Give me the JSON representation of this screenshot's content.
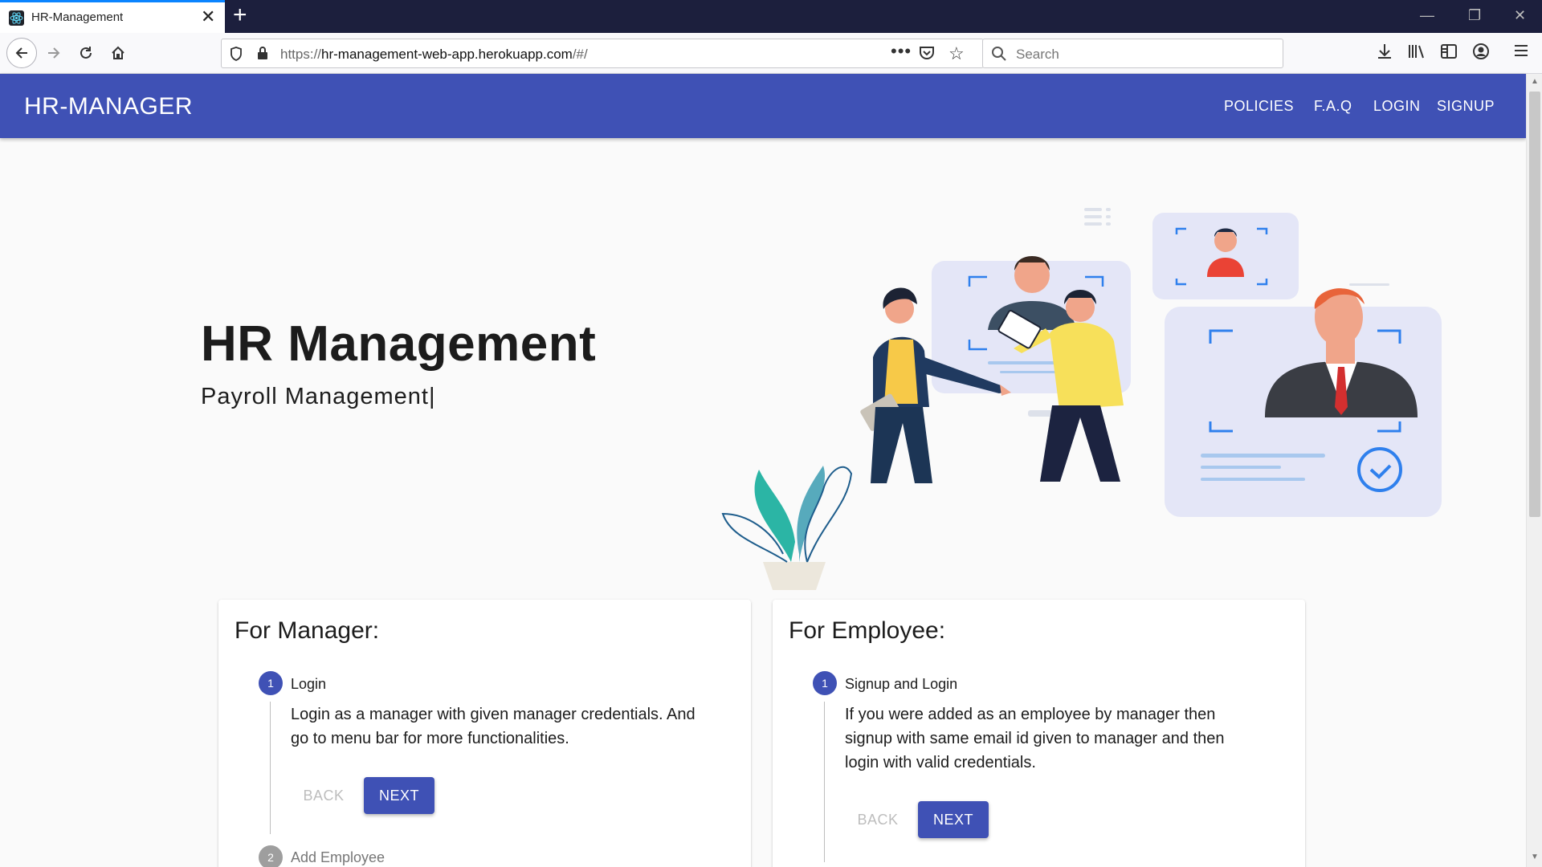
{
  "browser": {
    "tab_title": "HR-Management",
    "url_prefix": "https://",
    "url_host": "hr-management-web-app.herokuapp.com",
    "url_path": "/#/",
    "search_placeholder": "Search"
  },
  "app": {
    "brand": "HR-MANAGER",
    "nav": [
      {
        "label": "POLICIES"
      },
      {
        "label": "F.A.Q"
      },
      {
        "label": "LOGIN"
      },
      {
        "label": "SIGNUP"
      }
    ],
    "accent_color": "#3f51b5"
  },
  "hero": {
    "title": "HR Management",
    "subtitle": "Payroll Management"
  },
  "manager_card": {
    "heading": "For Manager:",
    "steps": [
      {
        "number": "1",
        "label": "Login",
        "description": "Login as a manager with given manager credentials. And go to menu bar for more functionalities."
      },
      {
        "number": "2",
        "label": "Add Employee"
      }
    ],
    "back_label": "BACK",
    "next_label": "NEXT"
  },
  "employee_card": {
    "heading": "For Employee:",
    "steps": [
      {
        "number": "1",
        "label": "Signup and Login",
        "description": "If you were added as an employee by manager then signup with same email id given to manager and then login with valid credentials."
      }
    ],
    "back_label": "BACK",
    "next_label": "NEXT"
  }
}
